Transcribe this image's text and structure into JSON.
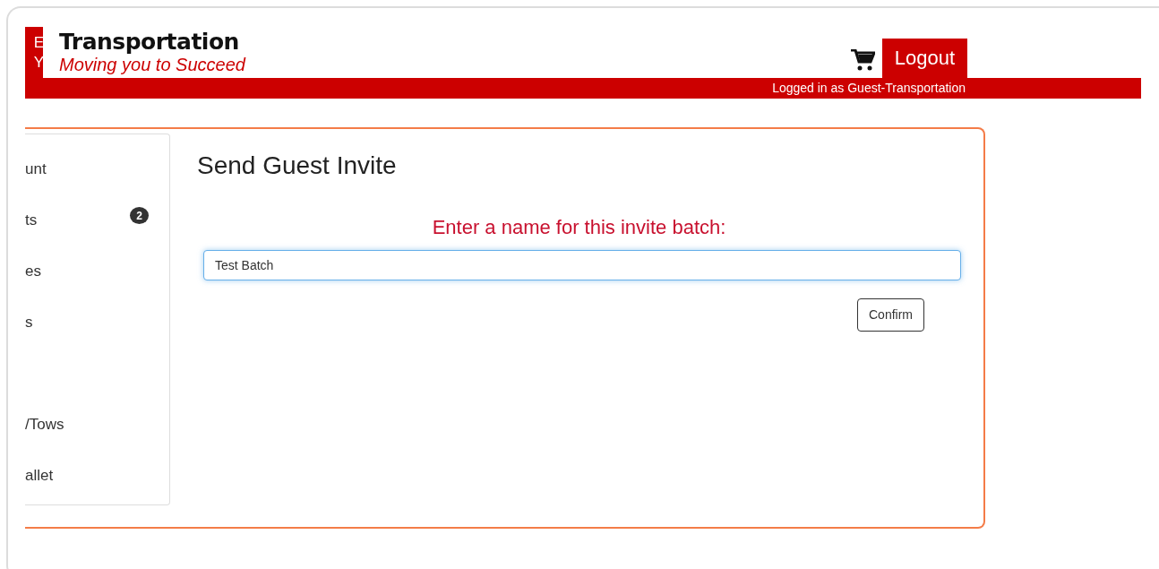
{
  "logo": {
    "letters": [
      "E",
      "Y"
    ],
    "title": "Transportation",
    "tagline": "Moving you to Succeed"
  },
  "header": {
    "logout": "Logout",
    "logged_in": "Logged in as Guest-Transportation"
  },
  "sidebar": {
    "items": [
      {
        "label": "unt"
      },
      {
        "label": "ts",
        "badge": "2"
      },
      {
        "label": "es"
      },
      {
        "label": "s"
      },
      {
        "label": "/Tows"
      },
      {
        "label": "allet"
      }
    ]
  },
  "main": {
    "title": "Send Guest Invite",
    "prompt": "Enter a name for this invite batch:",
    "field_value": "Test Batch",
    "field_focused": true,
    "confirm": "Confirm"
  }
}
